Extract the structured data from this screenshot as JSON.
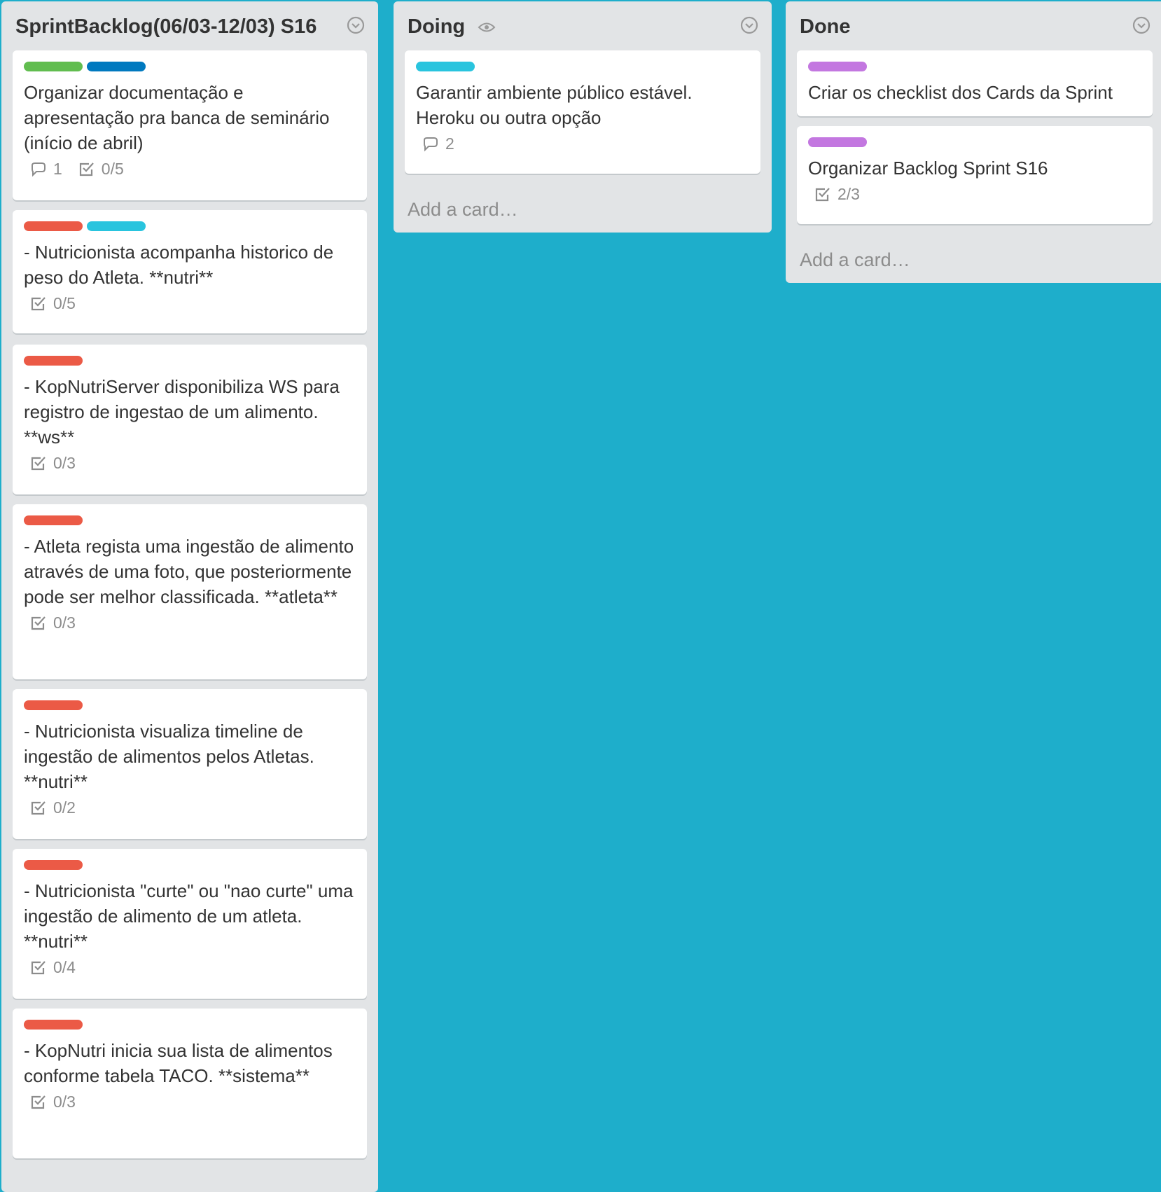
{
  "colors": {
    "board_background": "#1EAECB",
    "green": "#61BD4F",
    "blue": "#0079BF",
    "red": "#EB5A46",
    "sky": "#29C4DE",
    "purple": "#C377E0"
  },
  "lists": [
    {
      "title": "SprintBacklog(06/03-12/03) S16",
      "cards": [
        {
          "labels": [
            "green",
            "blue"
          ],
          "text": "Organizar documentação e apresentação pra banca de seminário (início de abril)",
          "comments": "1",
          "checklist": "0/5"
        },
        {
          "labels": [
            "red",
            "sky"
          ],
          "text": "- Nutricionista acompanha historico de peso do Atleta. **nutri**",
          "checklist": "0/5"
        },
        {
          "labels": [
            "red"
          ],
          "text": "- KopNutriServer disponibiliza WS para registro de ingestao de um alimento. **ws**",
          "checklist": "0/3"
        },
        {
          "labels": [
            "red"
          ],
          "text": "- Atleta regista uma ingestão de alimento através de uma foto, que posteriormente pode ser melhor classificada. **atleta**",
          "checklist": "0/3"
        },
        {
          "labels": [
            "red"
          ],
          "text": "- Nutricionista visualiza timeline de ingestão de alimentos pelos Atletas. **nutri**",
          "checklist": "0/2"
        },
        {
          "labels": [
            "red"
          ],
          "text": "- Nutricionista \"curte\" ou \"nao curte\" uma ingestão de alimento de um atleta. **nutri**",
          "checklist": "0/4"
        },
        {
          "labels": [
            "red"
          ],
          "text": "- KopNutri inicia sua lista de alimentos conforme tabela TACO. **sistema**",
          "checklist": "0/3"
        }
      ]
    },
    {
      "title": "Doing",
      "watch_icon": "eye-icon",
      "cards": [
        {
          "labels": [
            "sky"
          ],
          "text": "Garantir ambiente público estável. Heroku ou outra opção",
          "comments": "2"
        }
      ],
      "add_card": "Add a card…"
    },
    {
      "title": "Done",
      "cards": [
        {
          "labels": [
            "purple"
          ],
          "text": "Criar os checklist dos Cards da Sprint"
        },
        {
          "labels": [
            "purple"
          ],
          "text": "Organizar Backlog Sprint S16",
          "checklist": "2/3"
        }
      ],
      "add_card": "Add a card…"
    }
  ]
}
